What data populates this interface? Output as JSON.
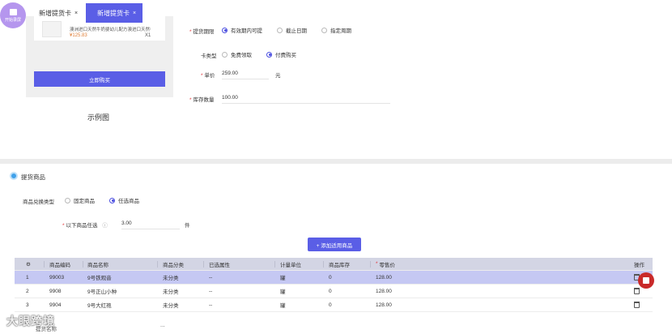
{
  "launcher": {
    "label": "开始录屏"
  },
  "tabs": [
    {
      "label": "新增提货卡",
      "close": "×"
    },
    {
      "label": "新增提货卡",
      "close": "×"
    }
  ],
  "preview": {
    "product_name": "澳洲进口天然牛奶婴幼儿配方澳进口天然牛奶酱",
    "price": "¥125.83",
    "quantity": "X1",
    "buy_button": "立即购买",
    "caption": "示例图"
  },
  "form": {
    "validity": {
      "label": "提货期限",
      "options": [
        "有效期内可提",
        "截止日期",
        "指定周期"
      ],
      "selected": 0
    },
    "card_type": {
      "label": "卡类型",
      "options": [
        "免费领取",
        "付费购买"
      ],
      "selected": 1
    },
    "unit_price": {
      "label": "单价",
      "value": "259.00",
      "unit": "元"
    },
    "stock": {
      "label": "库存数量",
      "value": "100.00"
    }
  },
  "pickup_section": {
    "title": "提货商品",
    "exchange_type": {
      "label": "商品兑换类型",
      "options": [
        "固定商品",
        "任选商品"
      ],
      "selected": 1
    },
    "pick_any": {
      "label": "以下商品任选",
      "value": "3.00",
      "unit": "件"
    },
    "add_button": "+ 添加适用商品"
  },
  "table": {
    "headers": [
      "商品编码",
      "商品名称",
      "商品分类",
      "已选属性",
      "计量单位",
      "商品库存",
      "零售价",
      "操作"
    ],
    "rows": [
      {
        "idx": "1",
        "code": "99003",
        "name": "9号铁观音",
        "category": "未分类",
        "attr": "--",
        "unit": "罐",
        "stock": "0",
        "price": "128.00"
      },
      {
        "idx": "2",
        "code": "9908",
        "name": "9号正山小种",
        "category": "未分类",
        "attr": "--",
        "unit": "罐",
        "stock": "0",
        "price": "128.00"
      },
      {
        "idx": "3",
        "code": "9904",
        "name": "9号大红袍",
        "category": "未分类",
        "attr": "--",
        "unit": "罐",
        "stock": "0",
        "price": "128.00"
      }
    ]
  },
  "watermark": "大眼跨境",
  "partial_label": "提货名称",
  "ellipsis": "..."
}
